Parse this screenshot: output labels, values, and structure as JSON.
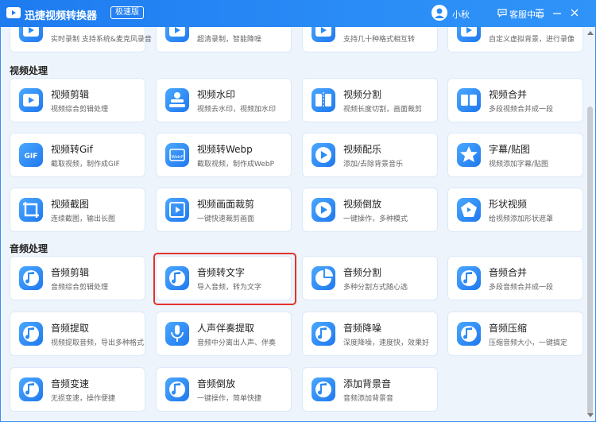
{
  "app": {
    "name": "迅捷视频转换器",
    "edition": "极速版"
  },
  "user": {
    "name": "小秋"
  },
  "header": {
    "customer_service": "客服中心"
  },
  "colors": {
    "titlebar": "#2186f4",
    "accent": "#1f86f0",
    "highlight": "#e0332b"
  },
  "sections": [
    {
      "title": "",
      "partial": true,
      "cards": [
        {
          "title": "",
          "desc": "实时录制 支持系统&麦克风录音",
          "icon": "screen-record-icon"
        },
        {
          "title": "",
          "desc": "超清录制，智能降噪",
          "icon": "hd-record-icon"
        },
        {
          "title": "",
          "desc": "支持几十种格式相互转",
          "icon": "format-convert-icon"
        },
        {
          "title": "",
          "desc": "自定义虚拟背景，进行录像",
          "icon": "virtual-bg-icon"
        }
      ]
    },
    {
      "title": "视频处理",
      "cards": [
        {
          "title": "视频剪辑",
          "desc": "视频综合剪辑处理",
          "icon": "video-edit-icon"
        },
        {
          "title": "视频水印",
          "desc": "视频去水印，视频加水印",
          "icon": "video-watermark-icon"
        },
        {
          "title": "视频分割",
          "desc": "视频长度切割，画面裁剪",
          "icon": "video-split-icon"
        },
        {
          "title": "视频合并",
          "desc": "多段视频合并成一段",
          "icon": "video-merge-icon"
        },
        {
          "title": "视频转Gif",
          "desc": "截取视频，制作成GIF",
          "icon": "gif-icon"
        },
        {
          "title": "视频转Webp",
          "desc": "截取视频，制作成WebP",
          "icon": "webp-icon"
        },
        {
          "title": "视频配乐",
          "desc": "添加/去除背景音乐",
          "icon": "video-music-icon"
        },
        {
          "title": "字幕/贴图",
          "desc": "视频添加字幕/贴图",
          "icon": "subtitle-star-icon"
        },
        {
          "title": "视频截图",
          "desc": "连续截图，输出长图",
          "icon": "video-screenshot-icon"
        },
        {
          "title": "视频画面裁剪",
          "desc": "一键快速裁剪画面",
          "icon": "video-crop-icon"
        },
        {
          "title": "视频倒放",
          "desc": "一键操作，多种模式",
          "icon": "video-reverse-icon"
        },
        {
          "title": "形状视频",
          "desc": "给视频添加形状遮罩",
          "icon": "shape-video-icon"
        }
      ]
    },
    {
      "title": "音频处理",
      "cards": [
        {
          "title": "音频剪辑",
          "desc": "音频综合剪辑处理",
          "icon": "audio-edit-icon"
        },
        {
          "title": "音频转文字",
          "desc": "导入音频，转为文字",
          "icon": "audio-to-text-icon"
        },
        {
          "title": "音频分割",
          "desc": "多种分割方式随心选",
          "icon": "audio-split-icon"
        },
        {
          "title": "音频合并",
          "desc": "多段音频合并成一段",
          "icon": "audio-merge-icon"
        },
        {
          "title": "音频提取",
          "desc": "视频提取音频，导出多种格式",
          "icon": "audio-extract-icon"
        },
        {
          "title": "人声伴奏提取",
          "desc": "音频中分离出人声、伴奏",
          "icon": "vocal-extract-icon"
        },
        {
          "title": "音频降噪",
          "desc": "深度降噪，速度快，效果好",
          "icon": "audio-denoise-icon"
        },
        {
          "title": "音频压缩",
          "desc": "压缩音频大小，一键搞定",
          "icon": "audio-compress-icon"
        },
        {
          "title": "音频变速",
          "desc": "无损变速，操作便捷",
          "icon": "audio-speed-icon"
        },
        {
          "title": "音频倒放",
          "desc": "一键操作，简单快捷",
          "icon": "audio-reverse-icon"
        },
        {
          "title": "添加背景音",
          "desc": "音频添加背景音",
          "icon": "add-bg-sound-icon"
        }
      ]
    }
  ]
}
